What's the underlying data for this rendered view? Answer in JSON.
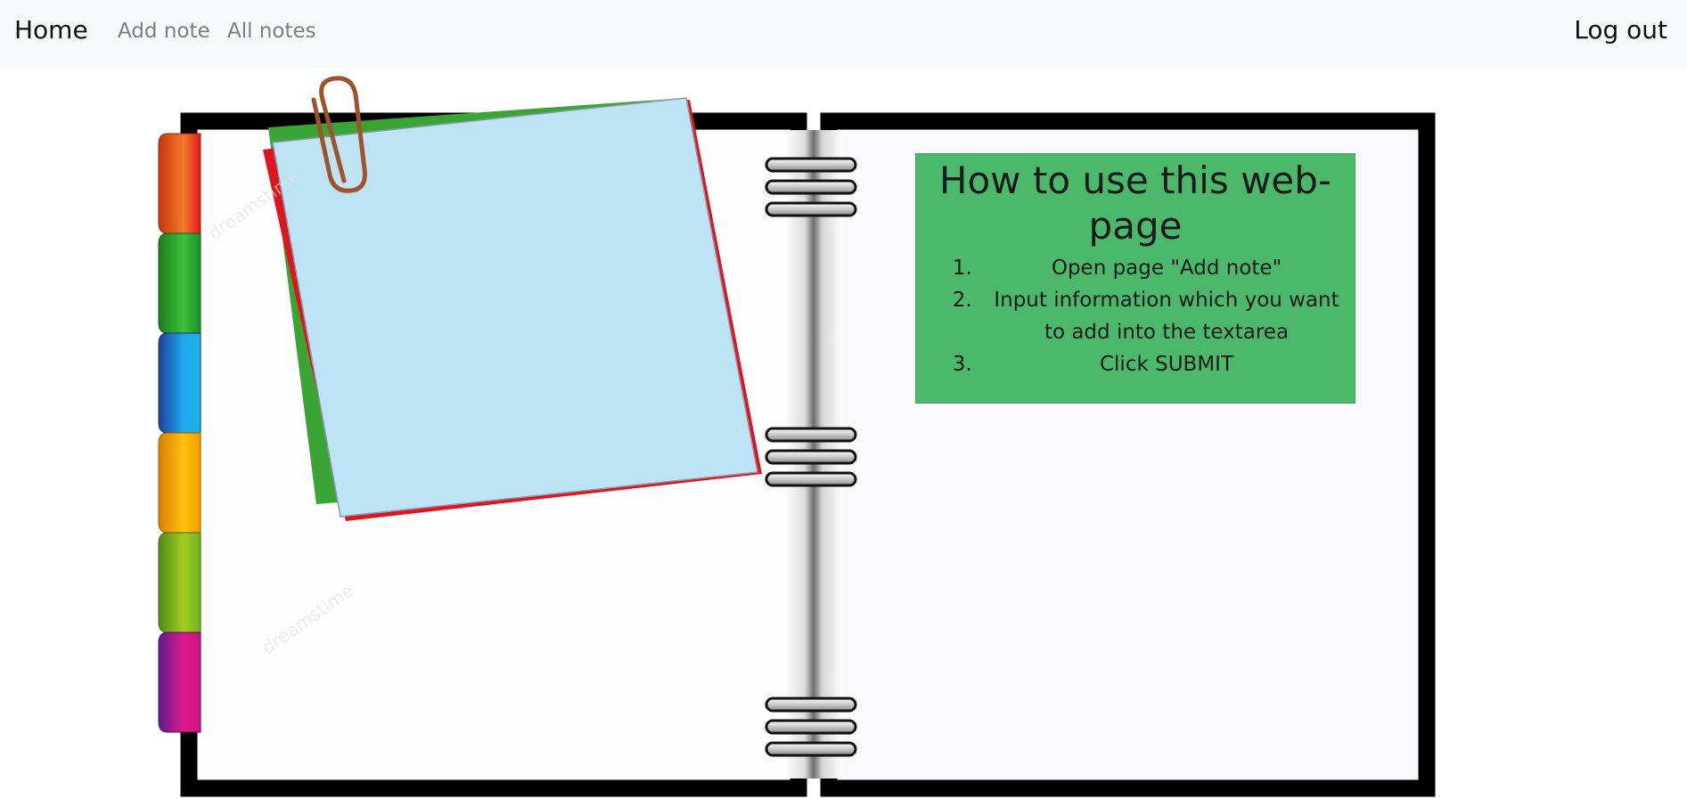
{
  "navbar": {
    "brand": "Home",
    "links": [
      {
        "label": "Add note"
      },
      {
        "label": "All notes"
      }
    ],
    "logout": "Log out"
  },
  "instructions": {
    "title": "How to use this web-page",
    "steps": [
      "Open page \"Add note\"",
      "Input information which you want to add into the textarea",
      "Click SUBMIT"
    ]
  },
  "illustration": {
    "tab_colors": [
      "#e8441a",
      "#2aa52a",
      "#1a8fe0",
      "#f5a300",
      "#7ab51d",
      "#c8167a"
    ],
    "sticky_note_colors": {
      "front": "#bde3f5",
      "green": "#3aa534",
      "red": "#e0141e"
    },
    "paperclip_color": "#a0522d",
    "watermark": "dreamstime"
  }
}
